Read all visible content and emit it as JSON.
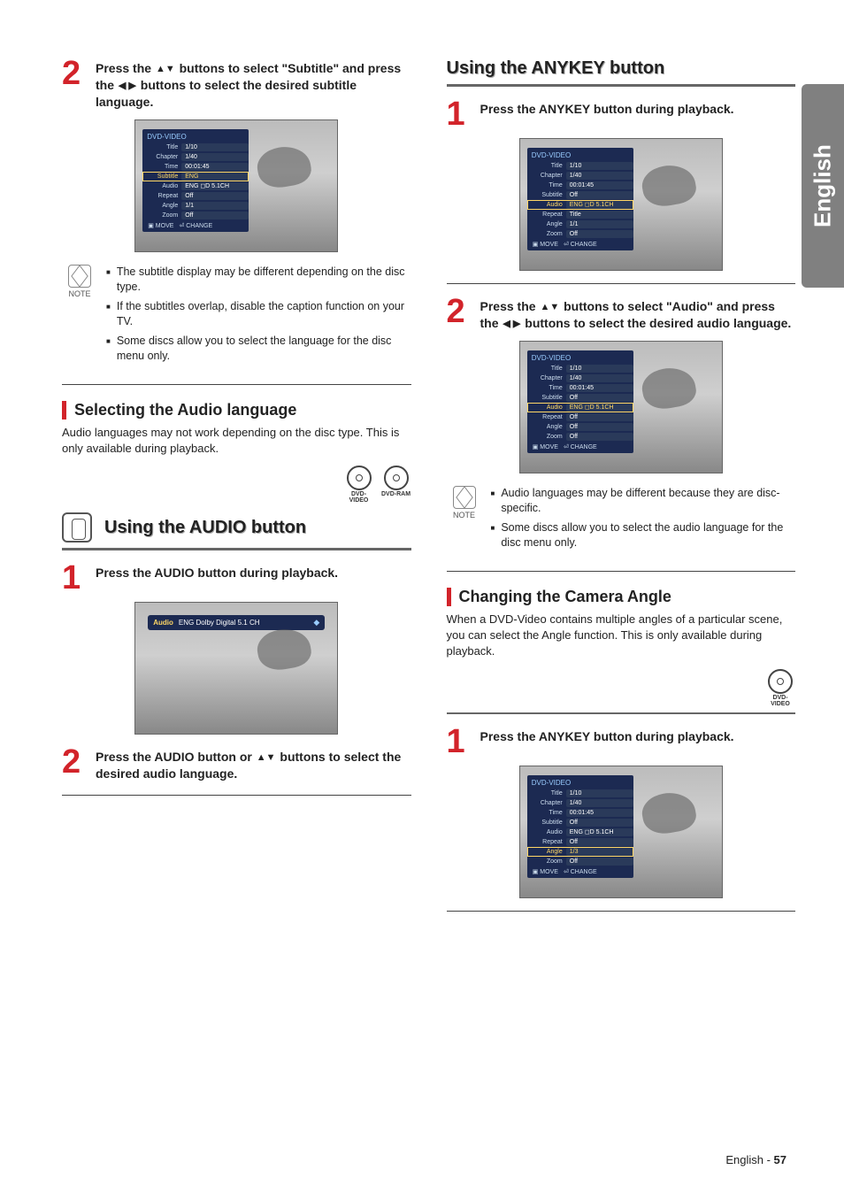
{
  "edge_tab": "English",
  "left": {
    "step2": {
      "prefix": "Press the ",
      "mid": " buttons to select \"Subtitle\" and press the ",
      "suffix": " buttons to select the desired subtitle language.",
      "glyph_ud": "▲▼",
      "glyph_lr": "◀ ▶"
    },
    "osd_subtitle": {
      "header": "DVD-VIDEO",
      "rows": [
        {
          "lab": "Title",
          "val": "1/10"
        },
        {
          "lab": "Chapter",
          "val": "1/40"
        },
        {
          "lab": "Time",
          "val": "00:01:45"
        },
        {
          "lab": "Subtitle",
          "val": "ENG",
          "sel": true
        },
        {
          "lab": "Audio",
          "val": "ENG ◻D 5.1CH"
        },
        {
          "lab": "Repeat",
          "val": "Off"
        },
        {
          "lab": "Angle",
          "val": "1/1"
        },
        {
          "lab": "Zoom",
          "val": "Off"
        }
      ],
      "foot_move": "MOVE",
      "foot_change": "CHANGE"
    },
    "note1_label": "NOTE",
    "note1": [
      "The subtitle display may be different depending on the disc type.",
      "If the subtitles overlap, disable the caption function on your TV.",
      "Some discs allow you to select the language for the disc menu only."
    ],
    "h_audio_lang": "Selecting the Audio language",
    "p_audio_lang": "Audio languages may not work depending on the disc type. This is only available during playback.",
    "badges": [
      "DVD-VIDEO",
      "DVD-RAM"
    ],
    "h_audio_btn": "Using the AUDIO button",
    "step_a1": "Press the AUDIO button during playback.",
    "audio_banner": {
      "lab": "Audio",
      "val": "ENG Dolby Digital 5.1 CH",
      "arrows": "◆"
    },
    "step_a2": {
      "prefix": "Press the AUDIO button or ",
      "glyph": "▲▼",
      "suffix": " buttons to select the desired audio language."
    }
  },
  "right": {
    "h_anykey": "Using the ANYKEY button",
    "step_b1": "Press the ANYKEY button during playback.",
    "osd_anykey": {
      "header": "DVD-VIDEO",
      "rows": [
        {
          "lab": "Title",
          "val": "1/10"
        },
        {
          "lab": "Chapter",
          "val": "1/40"
        },
        {
          "lab": "Time",
          "val": "00:01:45"
        },
        {
          "lab": "Subtitle",
          "val": "Off"
        },
        {
          "lab": "Audio",
          "val": "ENG ◻D 5.1CH",
          "sel": true
        },
        {
          "lab": "Repeat",
          "val": "Title"
        },
        {
          "lab": "Angle",
          "val": "1/1"
        },
        {
          "lab": "Zoom",
          "val": "Off"
        }
      ],
      "foot_move": "MOVE",
      "foot_change": "CHANGE"
    },
    "step_b2": {
      "prefix": "Press the ",
      "g1": "▲▼",
      "mid": " buttons to select \"Audio\" and press the ",
      "g2": "◀ ▶",
      "suffix": " buttons to select the desired audio language."
    },
    "osd_audio_sel": {
      "header": "DVD-VIDEO",
      "rows": [
        {
          "lab": "Title",
          "val": "1/10"
        },
        {
          "lab": "Chapter",
          "val": "1/40"
        },
        {
          "lab": "Time",
          "val": "00:01:45"
        },
        {
          "lab": "Subtitle",
          "val": "Off"
        },
        {
          "lab": "Audio",
          "val": "ENG ◻D 5.1CH",
          "sel": true
        },
        {
          "lab": "Repeat",
          "val": "Off"
        },
        {
          "lab": "Angle",
          "val": "Off"
        },
        {
          "lab": "Zoom",
          "val": "Off"
        }
      ],
      "foot_move": "MOVE",
      "foot_change": "CHANGE"
    },
    "note2_label": "NOTE",
    "note2": [
      "Audio languages may be different because they are disc-specific.",
      "Some discs allow you to select the audio language for the disc menu only."
    ],
    "h_angle": "Changing the Camera Angle",
    "p_angle": "When a DVD-Video contains multiple angles of a particular scene, you can select the Angle function. This is only available during playback.",
    "badges": [
      "DVD-VIDEO"
    ],
    "step_c1": "Press the ANYKEY button during playback.",
    "osd_angle": {
      "header": "DVD-VIDEO",
      "rows": [
        {
          "lab": "Title",
          "val": "1/10"
        },
        {
          "lab": "Chapter",
          "val": "1/40"
        },
        {
          "lab": "Time",
          "val": "00:01:45"
        },
        {
          "lab": "Subtitle",
          "val": "Off"
        },
        {
          "lab": "Audio",
          "val": "ENG ◻D 5.1CH"
        },
        {
          "lab": "Repeat",
          "val": "Off"
        },
        {
          "lab": "Angle",
          "val": "1/3",
          "sel": true
        },
        {
          "lab": "Zoom",
          "val": "Off"
        }
      ],
      "foot_move": "MOVE",
      "foot_change": "CHANGE"
    }
  },
  "footer": {
    "lang": "English",
    "sep": " - ",
    "page": "57"
  }
}
